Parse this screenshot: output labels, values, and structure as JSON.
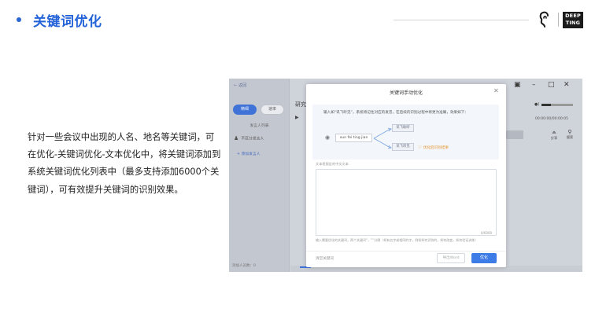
{
  "header": {
    "title": "关键词优化",
    "brand_line1": "DEEP",
    "brand_line2": "TING"
  },
  "description": "针对一些会议中出现的人名、地名等关键词，可在优化-关键词优化-文本优化中，将关键词添加到系统关键词优化列表中（最多支持添加6000个关键词），可有效提升关键词的识别效果。",
  "app": {
    "back_label": "返回",
    "tabs": [
      "精细",
      "速率"
    ],
    "speaker_list_label": "发言人列表",
    "speaker_row": "不区分发言人",
    "add_speaker": "添加发言人",
    "footer": "添加人员数：0",
    "doc_title": "研究",
    "time_readout": "00:00:00/00:00:05",
    "tools": [
      "分享",
      "搜索"
    ],
    "modal": {
      "title": "关键词手动优化",
      "example_hint": "输入如“讯飞听见”，系统将记住对应的发音，在后续的识别过程中将更为准确，效果如下：",
      "pinyin": "xun fei ting jian",
      "candidate_top": "讯飞助听",
      "candidate_bottom": "讯飞听见",
      "result_label": "优化后识别结果",
      "textarea_label": "文本框限定的中文文本",
      "char_count": "0/6000",
      "help": "输入需要优化的关键词，两个关键词“，”“分隔（如有名字或相同的字，例如如何识别的，如何改变，如何验证训练）",
      "clear_label": "清空关键词",
      "export_label": "导出Word",
      "optimize_label": "优化"
    }
  }
}
